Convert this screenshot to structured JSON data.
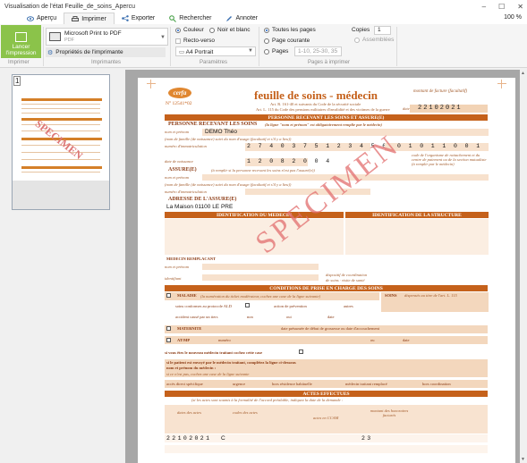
{
  "window": {
    "title": "Visualisation de l'état Feuille_de_soins_Apercu",
    "controls": [
      "–",
      "☐",
      "✕"
    ]
  },
  "tabs": [
    {
      "label": "Aperçu",
      "icon": "eye-icon"
    },
    {
      "label": "Imprimer",
      "icon": "printer-icon"
    },
    {
      "label": "Exporter",
      "icon": "share-icon"
    },
    {
      "label": "Rechercher",
      "icon": "search-icon"
    },
    {
      "label": "Annoter",
      "icon": "pen-icon"
    }
  ],
  "zoom": "100 %",
  "ribbon": {
    "launch_label": "Lancer l'impression",
    "printer_name": "Microsoft Print to PDF",
    "printer_sub": "PDF",
    "properties_label": "Propriétés de l'imprimante",
    "color_label": "Couleur",
    "bw_label": "Noir et blanc",
    "duplex_label": "Recto-verso",
    "paper_label": "A4 Portrait",
    "all_pages_label": "Toutes les pages",
    "current_page_label": "Page courante",
    "pages_label": "Pages",
    "pages_placeholder": "1-10, 25-30, 35",
    "copies_label": "Copies",
    "copies_value": "1",
    "collate_label": "Assemblées",
    "groups": {
      "print": "Imprimer",
      "printers": "Imprimantes",
      "params": "Paramètres",
      "pages": "Pages à imprimer"
    }
  },
  "thumbnail": {
    "page_number": "1",
    "watermark": "SPECIMEN"
  },
  "document": {
    "cerfa": "cerfa",
    "cerfa_number": "N° 12541*02",
    "title": "feuille de soins - médecin",
    "article_1": "Art. R. 161-40 et suivants du Code de la sécurité sociale",
    "article_2": "Art. L. 115 du Code des pensions militaires d'invalidité et des victimes de la guerre",
    "date_label": "montant de facture (facultatif)",
    "date_value": "22102021",
    "date_prefix": "date",
    "section_patient": "PERSONNE RECEVANT LES SOINS ET ASSURE(E)",
    "sub_patient": "PERSONNE RECEVANT LES SOINS",
    "sub_patient_note": "(la ligne \"nom et prénom\" est obligatoirement remplie par le médecin)",
    "lbl_nom": "nom et prénom",
    "patient_name": "DEMO Théo",
    "lbl_nom_famille": "(nom de famille (de naissance) suivi du nom d'usage (facultatif et s'il y a lieu))",
    "lbl_immat": "numéro d'immatriculation",
    "immat_value": "2 7 4 0 3 7 5 1 2 3 4 5 6   7 8",
    "org_value": "0 1 0 1 1 0 0 1",
    "org_note": "code de l'organisme de rattachement et du centre de paiement ou de la section mutualiste (à remplir par le médecin)",
    "lbl_naissance": "date de naissance",
    "birth_value": "1 2 0 8 2 0 0 4",
    "sub_assure": "ASSURE(E)",
    "sub_assure_note": "(à remplir si la personne recevant les soins n'est pas l'assuré(e))",
    "sub_adresse": "ADRESSE DE L'ASSURE(E)",
    "address_value": "La Maison 01100 LE PRE",
    "section_medecin": "IDENTIFICATION DU MEDECIN",
    "section_structure": "IDENTIFICATION DE LA STRUCTURE",
    "lbl_remplacant": "MEDECIN REMPLACANT",
    "lbl_identifiant": "identifiant",
    "lbl_coord": "dispositif de coordination",
    "lbl_coord2": "de soins · visite de santé",
    "section_conditions": "CONDITIONS DE PRISE EN CHARGE DES SOINS",
    "lbl_maladie": "MALADIE",
    "lbl_maladie_note": "(la numération du ticket modérateur, cochez une case de la ligne suivante)",
    "lbl_soins": "SOINS",
    "lbl_soins_note": "dispensés au titre de l'art. L. 115",
    "lbl_ald": "soins conformes au protocole ALD",
    "lbl_prevention": "action de prévention",
    "lbl_autres": "autres",
    "lbl_accident": "accident causé par un tiers",
    "lbl_non": "non",
    "lbl_oui": "oui",
    "lbl_date": "date",
    "lbl_maternite": "MATERNITE",
    "lbl_maternite_date": "date présumée de début de grossesse ou date d'accouchement",
    "lbl_atmp": "AT/MP",
    "lbl_numero": "numéro",
    "lbl_ou": "ou",
    "lbl_traitant": "si vous êtes le nouveau médecin traitant cochez cette case",
    "lbl_envoye": "si le patient est envoyé par le médecin traitant, complétez la ligne ci-dessous",
    "lbl_nom_med": "nom et prénom du médecin :",
    "lbl_cas": "si ce n'est pas, cochez une case de la ligne suivante",
    "acces": [
      "accès direct spécifique",
      "urgence",
      "hors résidence habituelle",
      "médecin traitant remplacé",
      "hors coordination"
    ],
    "section_actes": "ACTES EFFECTUES",
    "actes_note": "(si les actes sont soumis à la formalité de l'accord préalable, indiquez la date de la demande :",
    "col_date": "dates des actes",
    "col_codes": "codes des actes",
    "col_ccam": "actes en CCAM",
    "col_montant": "montant des honoraires facturés",
    "row_date": "22102021",
    "row_code": "C",
    "row_amount": "23",
    "watermark": "SPECIMEN"
  }
}
